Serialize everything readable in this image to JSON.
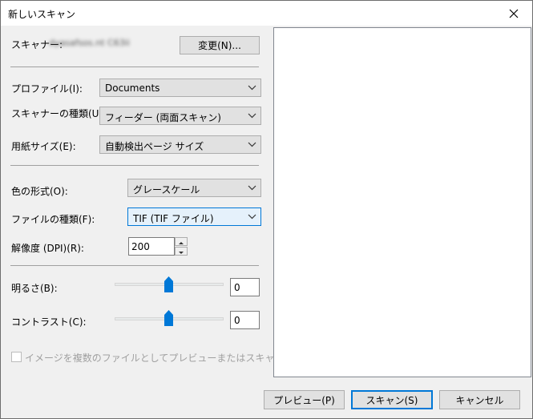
{
  "window": {
    "title": "新しいスキャン"
  },
  "scanner": {
    "label": "スキャナー:",
    "name": "dyasafsos.nt C63ii",
    "change_button": "変更(N)..."
  },
  "profile": {
    "label": "プロファイル(I):",
    "value": "Documents"
  },
  "source": {
    "label": "スキャナーの種類(U):",
    "value": "フィーダー (両面スキャン)"
  },
  "paper_size": {
    "label": "用紙サイズ(E):",
    "value": "自動検出ページ サイズ"
  },
  "color_format": {
    "label": "色の形式(O):",
    "value": "グレースケール"
  },
  "file_type": {
    "label": "ファイルの種類(F):",
    "value": "TIF (TIF ファイル)"
  },
  "resolution": {
    "label": "解像度 (DPI)(R):",
    "value": "200"
  },
  "brightness": {
    "label": "明るさ(B):",
    "value": "0",
    "level": 0
  },
  "contrast": {
    "label": "コントラスト(C):",
    "value": "0",
    "level": 0
  },
  "preview_checkbox": {
    "label": "イメージを複数のファイルとしてプレビューまたはスキャンする(T)",
    "checked": false,
    "enabled": false
  },
  "buttons": {
    "preview": "プレビュー(P)",
    "scan": "スキャン(S)",
    "cancel": "キャンセル"
  },
  "colors": {
    "accent": "#0078d7"
  }
}
